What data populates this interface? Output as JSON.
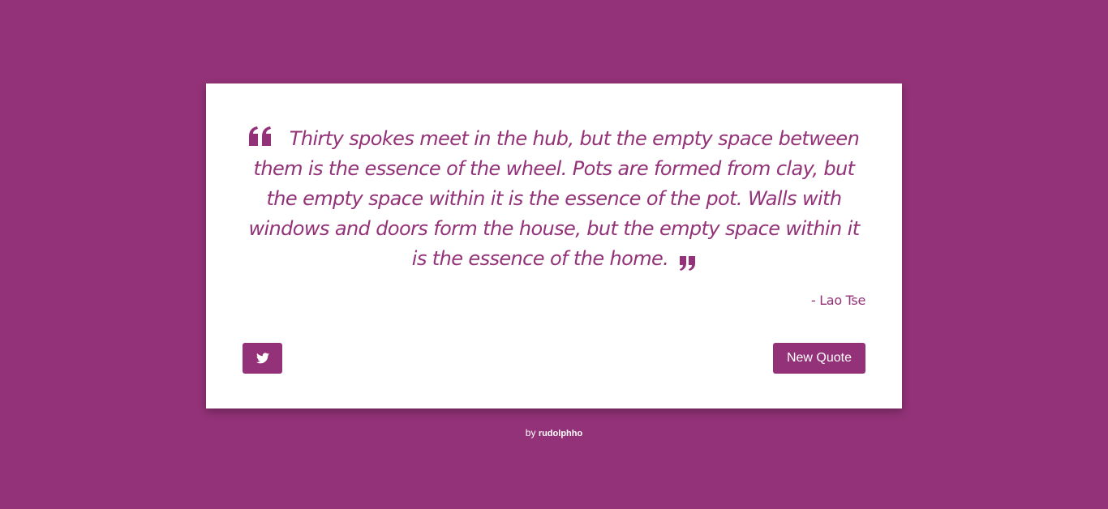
{
  "quote": {
    "text": "Thirty spokes meet in the hub, but the empty space between them is the essence of the wheel. Pots are formed from clay, but the empty space within it is the essence of the pot. Walls with windows and doors form the house, but the empty space within it is the essence of the home.",
    "author": "- Lao Tse",
    "open_icon": "quote-left-icon",
    "close_icon": "quote-right-icon"
  },
  "buttons": {
    "tweet_icon": "twitter-icon",
    "new_quote_label": "New Quote"
  },
  "footer": {
    "prefix": "by",
    "author": "rudolphho"
  },
  "colors": {
    "accent": "#933278",
    "card": "#ffffff"
  }
}
